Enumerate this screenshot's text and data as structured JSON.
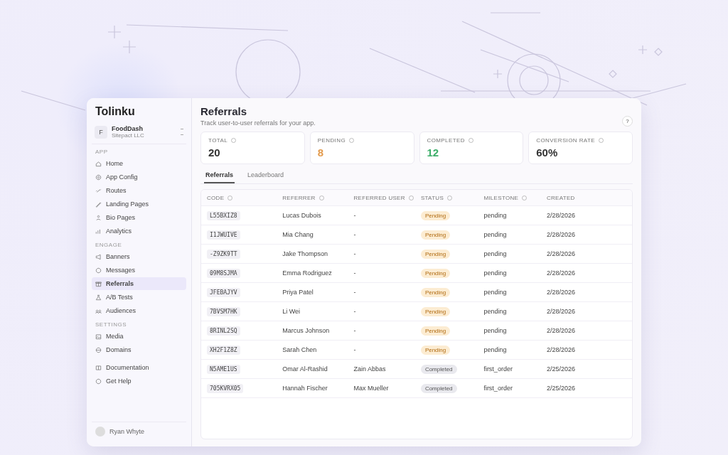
{
  "sidebar": {
    "logo": "Tolinku",
    "workspace": {
      "avatar": "F",
      "name": "FoodDash",
      "org": "Sitepact LLC"
    },
    "sections": [
      {
        "title": "APP",
        "items": [
          {
            "label": "Home",
            "selected": false
          },
          {
            "label": "App Config",
            "selected": false
          },
          {
            "label": "Routes",
            "selected": false
          },
          {
            "label": "Landing Pages",
            "selected": false
          },
          {
            "label": "Bio Pages",
            "selected": false
          },
          {
            "label": "Analytics",
            "selected": false
          }
        ]
      },
      {
        "title": "ENGAGE",
        "items": [
          {
            "label": "Banners",
            "selected": false
          },
          {
            "label": "Messages",
            "selected": false
          },
          {
            "label": "Referrals",
            "selected": true
          },
          {
            "label": "A/B Tests",
            "selected": false
          },
          {
            "label": "Audiences",
            "selected": false
          }
        ]
      },
      {
        "title": "SETTINGS",
        "items": [
          {
            "label": "Media",
            "selected": false
          },
          {
            "label": "Domains",
            "selected": false
          }
        ]
      },
      {
        "items": [
          {
            "label": "Documentation",
            "selected": false
          },
          {
            "label": "Get Help",
            "selected": false
          }
        ]
      }
    ],
    "user": {
      "name": "Ryan Whyte"
    }
  },
  "page": {
    "title": "Referrals",
    "subtitle": "Track user-to-user referrals for your app.",
    "help": "?"
  },
  "stats": [
    {
      "label": "TOTAL",
      "value": "20",
      "color": "#333333"
    },
    {
      "label": "PENDING",
      "value": "8",
      "color": "#e39a4c"
    },
    {
      "label": "COMPLETED",
      "value": "12",
      "color": "#3dae6a"
    },
    {
      "label": "CONVERSION RATE",
      "value": "60%",
      "color": "#333333"
    }
  ],
  "tabs": [
    {
      "label": "Referrals",
      "selected": true
    },
    {
      "label": "Leaderboard",
      "selected": false
    }
  ],
  "table": {
    "columns": [
      {
        "label": "CODE",
        "info": true
      },
      {
        "label": "REFERRER",
        "info": true
      },
      {
        "label": "REFERRED USER",
        "info": true
      },
      {
        "label": "STATUS",
        "info": true
      },
      {
        "label": "MILESTONE",
        "info": true
      },
      {
        "label": "CREATED",
        "info": false
      }
    ],
    "rows": [
      {
        "code": "L55BXIZ8",
        "referrer": "Lucas Dubois",
        "referred": "-",
        "status": "Pending",
        "milestone": "pending",
        "created": "2/28/2026"
      },
      {
        "code": "I1JWUIVE",
        "referrer": "Mia Chang",
        "referred": "-",
        "status": "Pending",
        "milestone": "pending",
        "created": "2/28/2026"
      },
      {
        "code": "-Z9ZK9TT",
        "referrer": "Jake Thompson",
        "referred": "-",
        "status": "Pending",
        "milestone": "pending",
        "created": "2/28/2026"
      },
      {
        "code": "09M8SJMA",
        "referrer": "Emma Rodriguez",
        "referred": "-",
        "status": "Pending",
        "milestone": "pending",
        "created": "2/28/2026"
      },
      {
        "code": "JFEBAJYV",
        "referrer": "Priya Patel",
        "referred": "-",
        "status": "Pending",
        "milestone": "pending",
        "created": "2/28/2026"
      },
      {
        "code": "7BVSM7HK",
        "referrer": "Li Wei",
        "referred": "-",
        "status": "Pending",
        "milestone": "pending",
        "created": "2/28/2026"
      },
      {
        "code": "8RINL2SQ",
        "referrer": "Marcus Johnson",
        "referred": "-",
        "status": "Pending",
        "milestone": "pending",
        "created": "2/28/2026"
      },
      {
        "code": "XH2F1Z8Z",
        "referrer": "Sarah Chen",
        "referred": "-",
        "status": "Pending",
        "milestone": "pending",
        "created": "2/28/2026"
      },
      {
        "code": "N5AME1US",
        "referrer": "Omar Al-Rashid",
        "referred": "Zain Abbas",
        "status": "Completed",
        "milestone": "first_order",
        "created": "2/25/2026"
      },
      {
        "code": "705KVRX05",
        "referrer": "Hannah Fischer",
        "referred": "Max Mueller",
        "status": "Completed",
        "milestone": "first_order",
        "created": "2/25/2026"
      }
    ]
  }
}
